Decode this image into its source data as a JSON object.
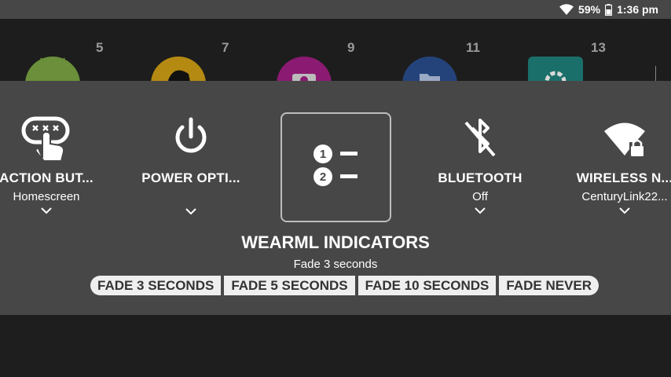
{
  "status": {
    "battery": "59%",
    "time": "1:36 pm"
  },
  "home_apps": [
    {
      "number": "5",
      "color": "#6b8f3b",
      "icon": "android-icon"
    },
    {
      "number": "7",
      "color": "#b58a12",
      "icon": "person-app-icon"
    },
    {
      "number": "9",
      "color": "#8b1a72",
      "icon": "camera-app-icon"
    },
    {
      "number": "11",
      "color": "#24437a",
      "icon": "folder-app-icon"
    },
    {
      "number": "13",
      "color": "#1b6f6a",
      "icon": "settings-app-icon"
    }
  ],
  "tiles": [
    {
      "title": "ACTION BUT...",
      "subtitle": "Homescreen",
      "icon": "action-button-icon"
    },
    {
      "title": "POWER OPTI...",
      "subtitle": "",
      "icon": "power-icon"
    },
    {
      "title": "",
      "subtitle": "",
      "icon": "numbered-list-icon"
    },
    {
      "title": "BLUETOOTH",
      "subtitle": "Off",
      "icon": "bluetooth-off-icon"
    },
    {
      "title": "WIRELESS N...",
      "subtitle": "CenturyLink22...",
      "icon": "wifi-lock-icon"
    }
  ],
  "selected": {
    "title": "WEARML INDICATORS",
    "value": "Fade 3 seconds"
  },
  "options": [
    "FADE 3 SECONDS",
    "FADE 5 SECONDS",
    "FADE 10 SECONDS",
    "FADE NEVER"
  ]
}
